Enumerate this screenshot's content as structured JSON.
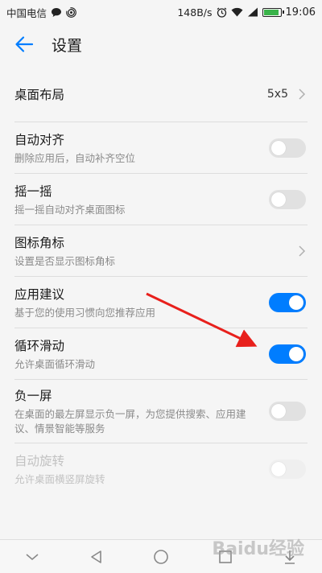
{
  "status_bar": {
    "carrier": "中国电信",
    "net_speed": "148B/s",
    "time": "19:06",
    "battery_level": 0.9,
    "battery_color": "#3ab34a"
  },
  "header": {
    "title": "设置"
  },
  "settings": [
    {
      "title": "桌面布局",
      "value": "5x5"
    },
    {
      "title": "自动对齐",
      "subtitle": "删除应用后，自动补齐空位",
      "toggle": "off"
    },
    {
      "title": "摇一摇",
      "subtitle": "摇一摇自动对齐桌面图标",
      "toggle": "off"
    },
    {
      "title": "图标角标",
      "subtitle": "设置是否显示图标角标"
    },
    {
      "title": "应用建议",
      "subtitle": "基于您的使用习惯向您推荐应用",
      "toggle": "on"
    },
    {
      "title": "循环滑动",
      "subtitle": "允许桌面循环滑动",
      "toggle": "on"
    },
    {
      "title": "负一屏",
      "subtitle": "在桌面的最左屏显示负一屏，为您提供搜索、应用建议、情景智能等服务",
      "toggle": "off"
    },
    {
      "title": "自动旋转",
      "subtitle": "允许桌面横竖屏旋转",
      "toggle": "disabled"
    }
  ],
  "colors": {
    "accent": "#007dff",
    "annotation_arrow": "#e8201c"
  },
  "watermark": "Baidu经验"
}
